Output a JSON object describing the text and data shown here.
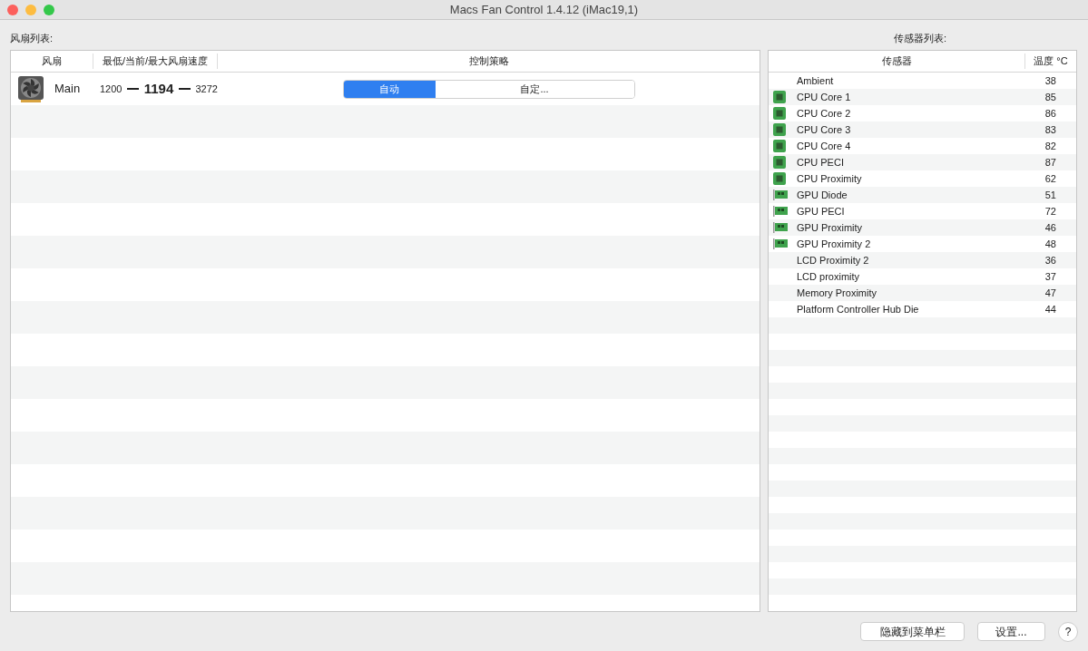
{
  "window": {
    "title": "Macs Fan Control 1.4.12 (iMac19,1)"
  },
  "fans": {
    "label": "风扇列表:",
    "columns": [
      "风扇",
      "最低/当前/最大风扇速度",
      "控制策略"
    ],
    "rows": [
      {
        "name": "Main",
        "min": "1200",
        "current": "1194",
        "max": "3272",
        "modes": [
          {
            "label": "自动",
            "selected": true
          },
          {
            "label": "自定...",
            "selected": false
          }
        ]
      }
    ]
  },
  "sensors": {
    "label": "传感器列表:",
    "columns": [
      "传感器",
      "温度 °C"
    ],
    "rows": [
      {
        "kind": "none",
        "name": "Ambient",
        "temp": "38"
      },
      {
        "kind": "cpu",
        "name": "CPU Core 1",
        "temp": "85"
      },
      {
        "kind": "cpu",
        "name": "CPU Core 2",
        "temp": "86"
      },
      {
        "kind": "cpu",
        "name": "CPU Core 3",
        "temp": "83"
      },
      {
        "kind": "cpu",
        "name": "CPU Core 4",
        "temp": "82"
      },
      {
        "kind": "cpu",
        "name": "CPU PECI",
        "temp": "87"
      },
      {
        "kind": "cpu",
        "name": "CPU Proximity",
        "temp": "62"
      },
      {
        "kind": "gpu",
        "name": "GPU Diode",
        "temp": "51"
      },
      {
        "kind": "gpu",
        "name": "GPU PECI",
        "temp": "72"
      },
      {
        "kind": "gpu",
        "name": "GPU Proximity",
        "temp": "46"
      },
      {
        "kind": "gpu",
        "name": "GPU Proximity 2",
        "temp": "48"
      },
      {
        "kind": "none",
        "name": "LCD Proximity 2",
        "temp": "36"
      },
      {
        "kind": "none",
        "name": "LCD proximity",
        "temp": "37"
      },
      {
        "kind": "none",
        "name": "Memory Proximity",
        "temp": "47"
      },
      {
        "kind": "none",
        "name": "Platform Controller Hub Die",
        "temp": "44"
      }
    ]
  },
  "buttons": [
    {
      "label": "隐藏到菜单栏"
    },
    {
      "label": "设置..."
    },
    {
      "label": "?"
    }
  ]
}
